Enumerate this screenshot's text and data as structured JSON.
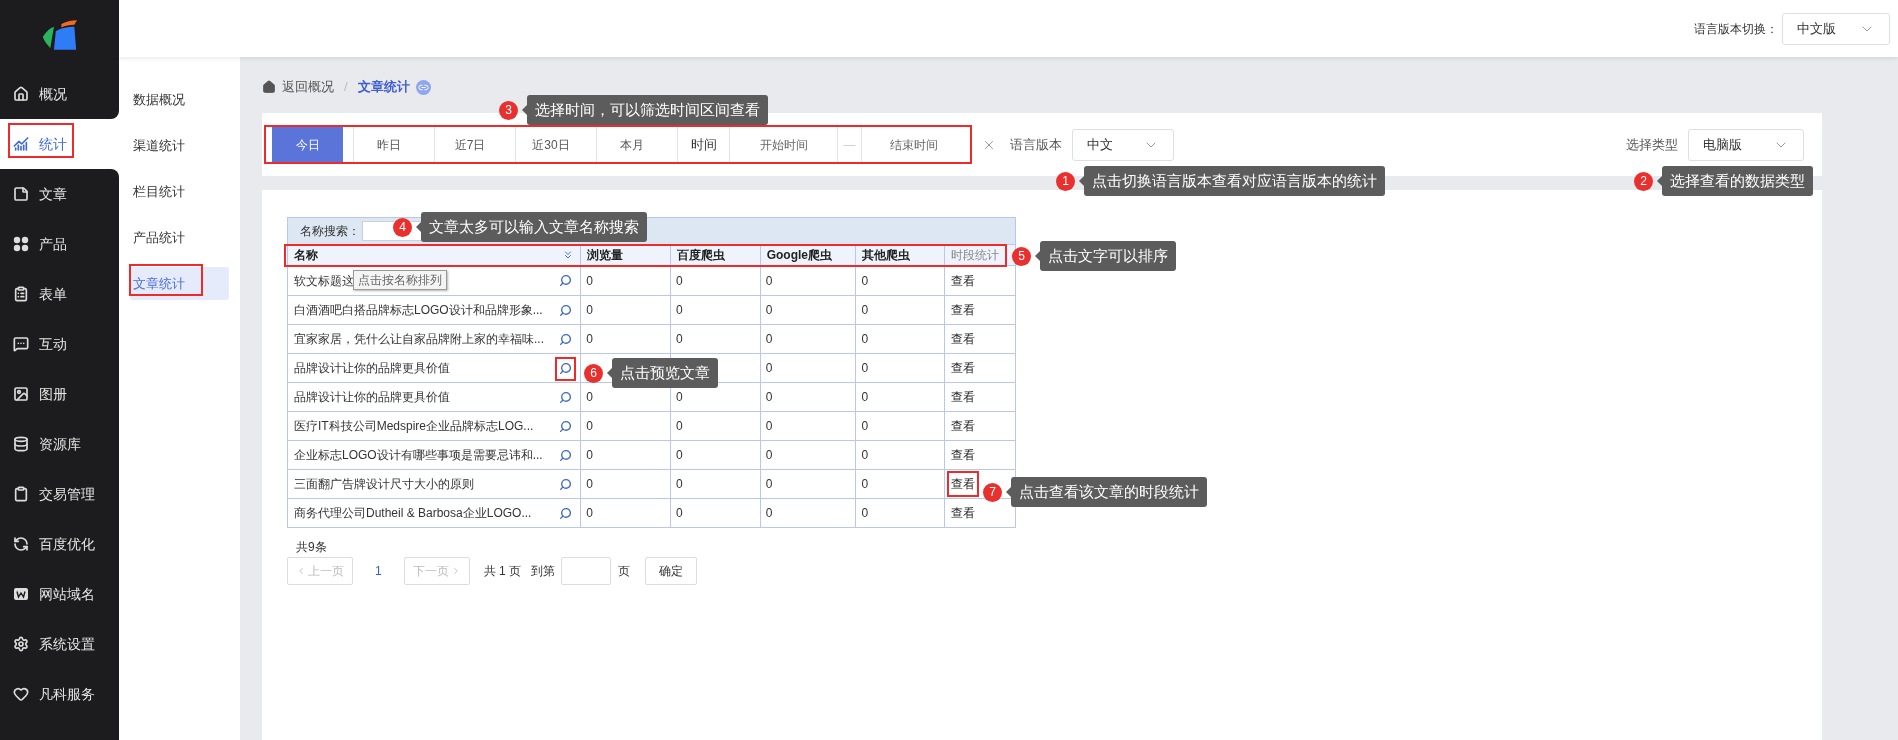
{
  "sidebar": {
    "items": [
      {
        "label": "概况",
        "selected": false
      },
      {
        "label": "统计",
        "selected": true
      },
      {
        "label": "文章",
        "selected": false
      },
      {
        "label": "产品",
        "selected": false
      },
      {
        "label": "表单",
        "selected": false
      },
      {
        "label": "互动",
        "selected": false
      },
      {
        "label": "图册",
        "selected": false
      },
      {
        "label": "资源库",
        "selected": false
      },
      {
        "label": "交易管理",
        "selected": false
      },
      {
        "label": "百度优化",
        "selected": false
      },
      {
        "label": "网站域名",
        "selected": false
      },
      {
        "label": "系统设置",
        "selected": false
      },
      {
        "label": "凡科服务",
        "selected": false
      }
    ]
  },
  "subnav": {
    "items": [
      {
        "label": "数据概况",
        "selected": false
      },
      {
        "label": "渠道统计",
        "selected": false
      },
      {
        "label": "栏目统计",
        "selected": false
      },
      {
        "label": "产品统计",
        "selected": false
      },
      {
        "label": "文章统计",
        "selected": true
      }
    ]
  },
  "header": {
    "language_label": "语言版本切换：",
    "language_value": "中文版"
  },
  "breadcrumb": {
    "back": "返回概况",
    "separator": "/",
    "current": "文章统计"
  },
  "filters": {
    "ranges": [
      {
        "label": "今日",
        "selected": true
      },
      {
        "label": "昨日",
        "selected": false
      },
      {
        "label": "近7日",
        "selected": false
      },
      {
        "label": "近30日",
        "selected": false
      },
      {
        "label": "本月",
        "selected": false
      }
    ],
    "time_label": "时间",
    "start_placeholder": "开始时间",
    "separator": "—",
    "end_placeholder": "结束时间",
    "language": {
      "label": "语言版本",
      "value": "中文"
    },
    "type": {
      "label": "选择类型",
      "value": "电脑版"
    }
  },
  "table": {
    "search_label": "名称搜索：",
    "columns": [
      "名称",
      "浏览量",
      "百度爬虫",
      "Google爬虫",
      "其他爬虫",
      "时段统计"
    ],
    "rows": [
      {
        "name": "软文标题这",
        "views": "0",
        "baidu": "0",
        "google": "0",
        "other": "0",
        "action": "查看"
      },
      {
        "name": "白酒酒吧白搭品牌标志LOGO设计和品牌形象...",
        "views": "0",
        "baidu": "0",
        "google": "0",
        "other": "0",
        "action": "查看"
      },
      {
        "name": "宜家家居，凭什么让自家品牌附上家的幸福味...",
        "views": "0",
        "baidu": "0",
        "google": "0",
        "other": "0",
        "action": "查看"
      },
      {
        "name": "品牌设计让你的品牌更具价值",
        "google": "0",
        "other": "0",
        "action": "查看"
      },
      {
        "name": "品牌设计让你的品牌更具价值",
        "views": "0",
        "baidu": "0",
        "google": "0",
        "other": "0",
        "action": "查看"
      },
      {
        "name": "医疗IT科技公司Medspire企业品牌标志LOG...",
        "views": "0",
        "baidu": "0",
        "google": "0",
        "other": "0",
        "action": "查看"
      },
      {
        "name": "企业标志LOGO设计有哪些事项是需要忌讳和...",
        "views": "0",
        "baidu": "0",
        "google": "0",
        "other": "0",
        "action": "查看"
      },
      {
        "name": "三面翻广告牌设计尺寸大小的原则",
        "views": "0",
        "baidu": "0",
        "google": "0",
        "other": "0",
        "action": "查看"
      },
      {
        "name": "商务代理公司Dutheil & Barbosa企业LOGO...",
        "views": "0",
        "baidu": "0",
        "google": "0",
        "other": "0",
        "action": "查看"
      }
    ],
    "tooltip": "点击按名称排列"
  },
  "pagination": {
    "total": "共9条",
    "prev": "上一页",
    "pages": [
      {
        "label": "1",
        "selected": true
      }
    ],
    "next": "下一页",
    "page_count": "共 1 页",
    "goto_label": "到第",
    "goto_suffix": "页",
    "confirm": "确定"
  },
  "annotations": [
    {
      "number": "1",
      "text": "点击切换语言版本查看对应语言版本的统计"
    },
    {
      "number": "2",
      "text": "选择查看的数据类型"
    },
    {
      "number": "3",
      "text": "选择时间，可以筛选时间区间查看"
    },
    {
      "number": "4",
      "text": "文章太多可以输入文章名称搜索"
    },
    {
      "number": "5",
      "text": "点击文字可以排序"
    },
    {
      "number": "6",
      "text": "点击预览文章"
    },
    {
      "number": "7",
      "text": "点击查看该文章的时段统计"
    }
  ]
}
